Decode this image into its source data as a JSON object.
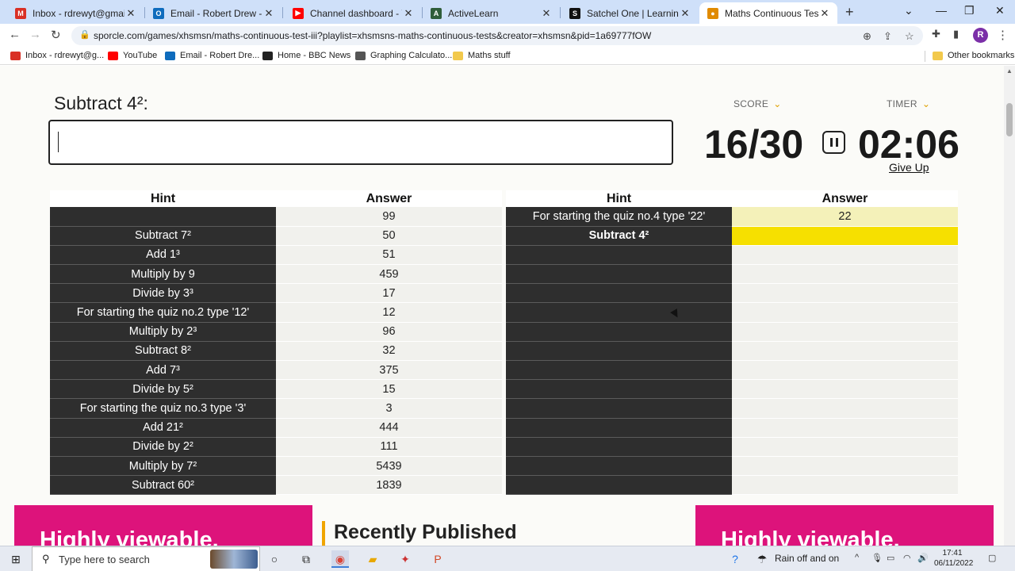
{
  "browser": {
    "tabs": [
      {
        "title": "Inbox - rdrewyt@gmail.com",
        "icon": "gmail-icon",
        "color": "#d93025",
        "glyph": "M"
      },
      {
        "title": "Email - Robert Drew - Outlook",
        "icon": "outlook-icon",
        "color": "#0f6cbd",
        "glyph": "O"
      },
      {
        "title": "Channel dashboard - YouTube",
        "icon": "youtube-icon",
        "color": "#ff0000",
        "glyph": "▶"
      },
      {
        "title": "ActiveLearn",
        "icon": "activelearn-icon",
        "color": "#2f5d3a",
        "glyph": "A"
      },
      {
        "title": "Satchel One | Learning platform",
        "icon": "satchel-icon",
        "color": "#111111",
        "glyph": "S"
      },
      {
        "title": "Maths Continuous Test III Quiz",
        "icon": "sporcle-icon",
        "color": "#e08a00",
        "glyph": "●"
      }
    ],
    "url": "sporcle.com/games/xhsmsn/maths-continuous-test-iii?playlist=xhsmsns-maths-continuous-tests&creator=xhsmsn&pid=1a69777fOW",
    "bookmarks": [
      {
        "label": "Inbox - rdrewyt@g...",
        "color": "#d93025"
      },
      {
        "label": "YouTube",
        "color": "#ff0000"
      },
      {
        "label": "Email - Robert Dre...",
        "color": "#0f6cbd"
      },
      {
        "label": "Home - BBC News",
        "color": "#222222"
      },
      {
        "label": "Graphing Calculato...",
        "color": "#555555"
      },
      {
        "label": "Maths stuff",
        "color": "#f2c94c"
      }
    ],
    "other_bookmarks": "Other bookmarks",
    "profile_initial": "R"
  },
  "quiz": {
    "prompt": "Subtract 4²:",
    "score_label": "SCORE",
    "timer_label": "TIMER",
    "score": "16/30",
    "timer": "02:06",
    "give_up": "Give Up",
    "hint_header": "Hint",
    "answer_header": "Answer",
    "left_rows": [
      {
        "hint": "",
        "answer": "99"
      },
      {
        "hint": "Subtract 7²",
        "answer": "50"
      },
      {
        "hint": "Add 1³",
        "answer": "51"
      },
      {
        "hint": "Multiply by 9",
        "answer": "459"
      },
      {
        "hint": "Divide by 3³",
        "answer": "17"
      },
      {
        "hint": "For starting the quiz no.2 type '12'",
        "answer": "12"
      },
      {
        "hint": "Multiply by 2³",
        "answer": "96"
      },
      {
        "hint": "Subtract 8²",
        "answer": "32"
      },
      {
        "hint": "Add 7³",
        "answer": "375"
      },
      {
        "hint": "Divide by 5²",
        "answer": "15"
      },
      {
        "hint": "For starting the quiz no.3 type '3'",
        "answer": "3"
      },
      {
        "hint": "Add 21²",
        "answer": "444"
      },
      {
        "hint": "Divide by 2²",
        "answer": "111"
      },
      {
        "hint": "Multiply by 7²",
        "answer": "5439"
      },
      {
        "hint": "Subtract 60²",
        "answer": "1839"
      }
    ],
    "right_rows": [
      {
        "hint": "For starting the quiz no.4 type '22'",
        "answer": "22",
        "state": "correct"
      },
      {
        "hint": "Subtract 4²",
        "answer": "",
        "state": "current"
      },
      {
        "hint": "",
        "answer": ""
      },
      {
        "hint": "",
        "answer": ""
      },
      {
        "hint": "",
        "answer": ""
      },
      {
        "hint": "",
        "answer": ""
      },
      {
        "hint": "",
        "answer": ""
      },
      {
        "hint": "",
        "answer": ""
      },
      {
        "hint": "",
        "answer": ""
      },
      {
        "hint": "",
        "answer": ""
      },
      {
        "hint": "",
        "answer": ""
      },
      {
        "hint": "",
        "answer": ""
      },
      {
        "hint": "",
        "answer": ""
      },
      {
        "hint": "",
        "answer": ""
      },
      {
        "hint": "",
        "answer": ""
      }
    ]
  },
  "below": {
    "ad_text": "Highly viewable.",
    "recently_published": "Recently Published"
  },
  "taskbar": {
    "search_placeholder": "Type here to search",
    "weather": "Rain off and on",
    "time": "17:41",
    "date": "06/11/2022"
  }
}
